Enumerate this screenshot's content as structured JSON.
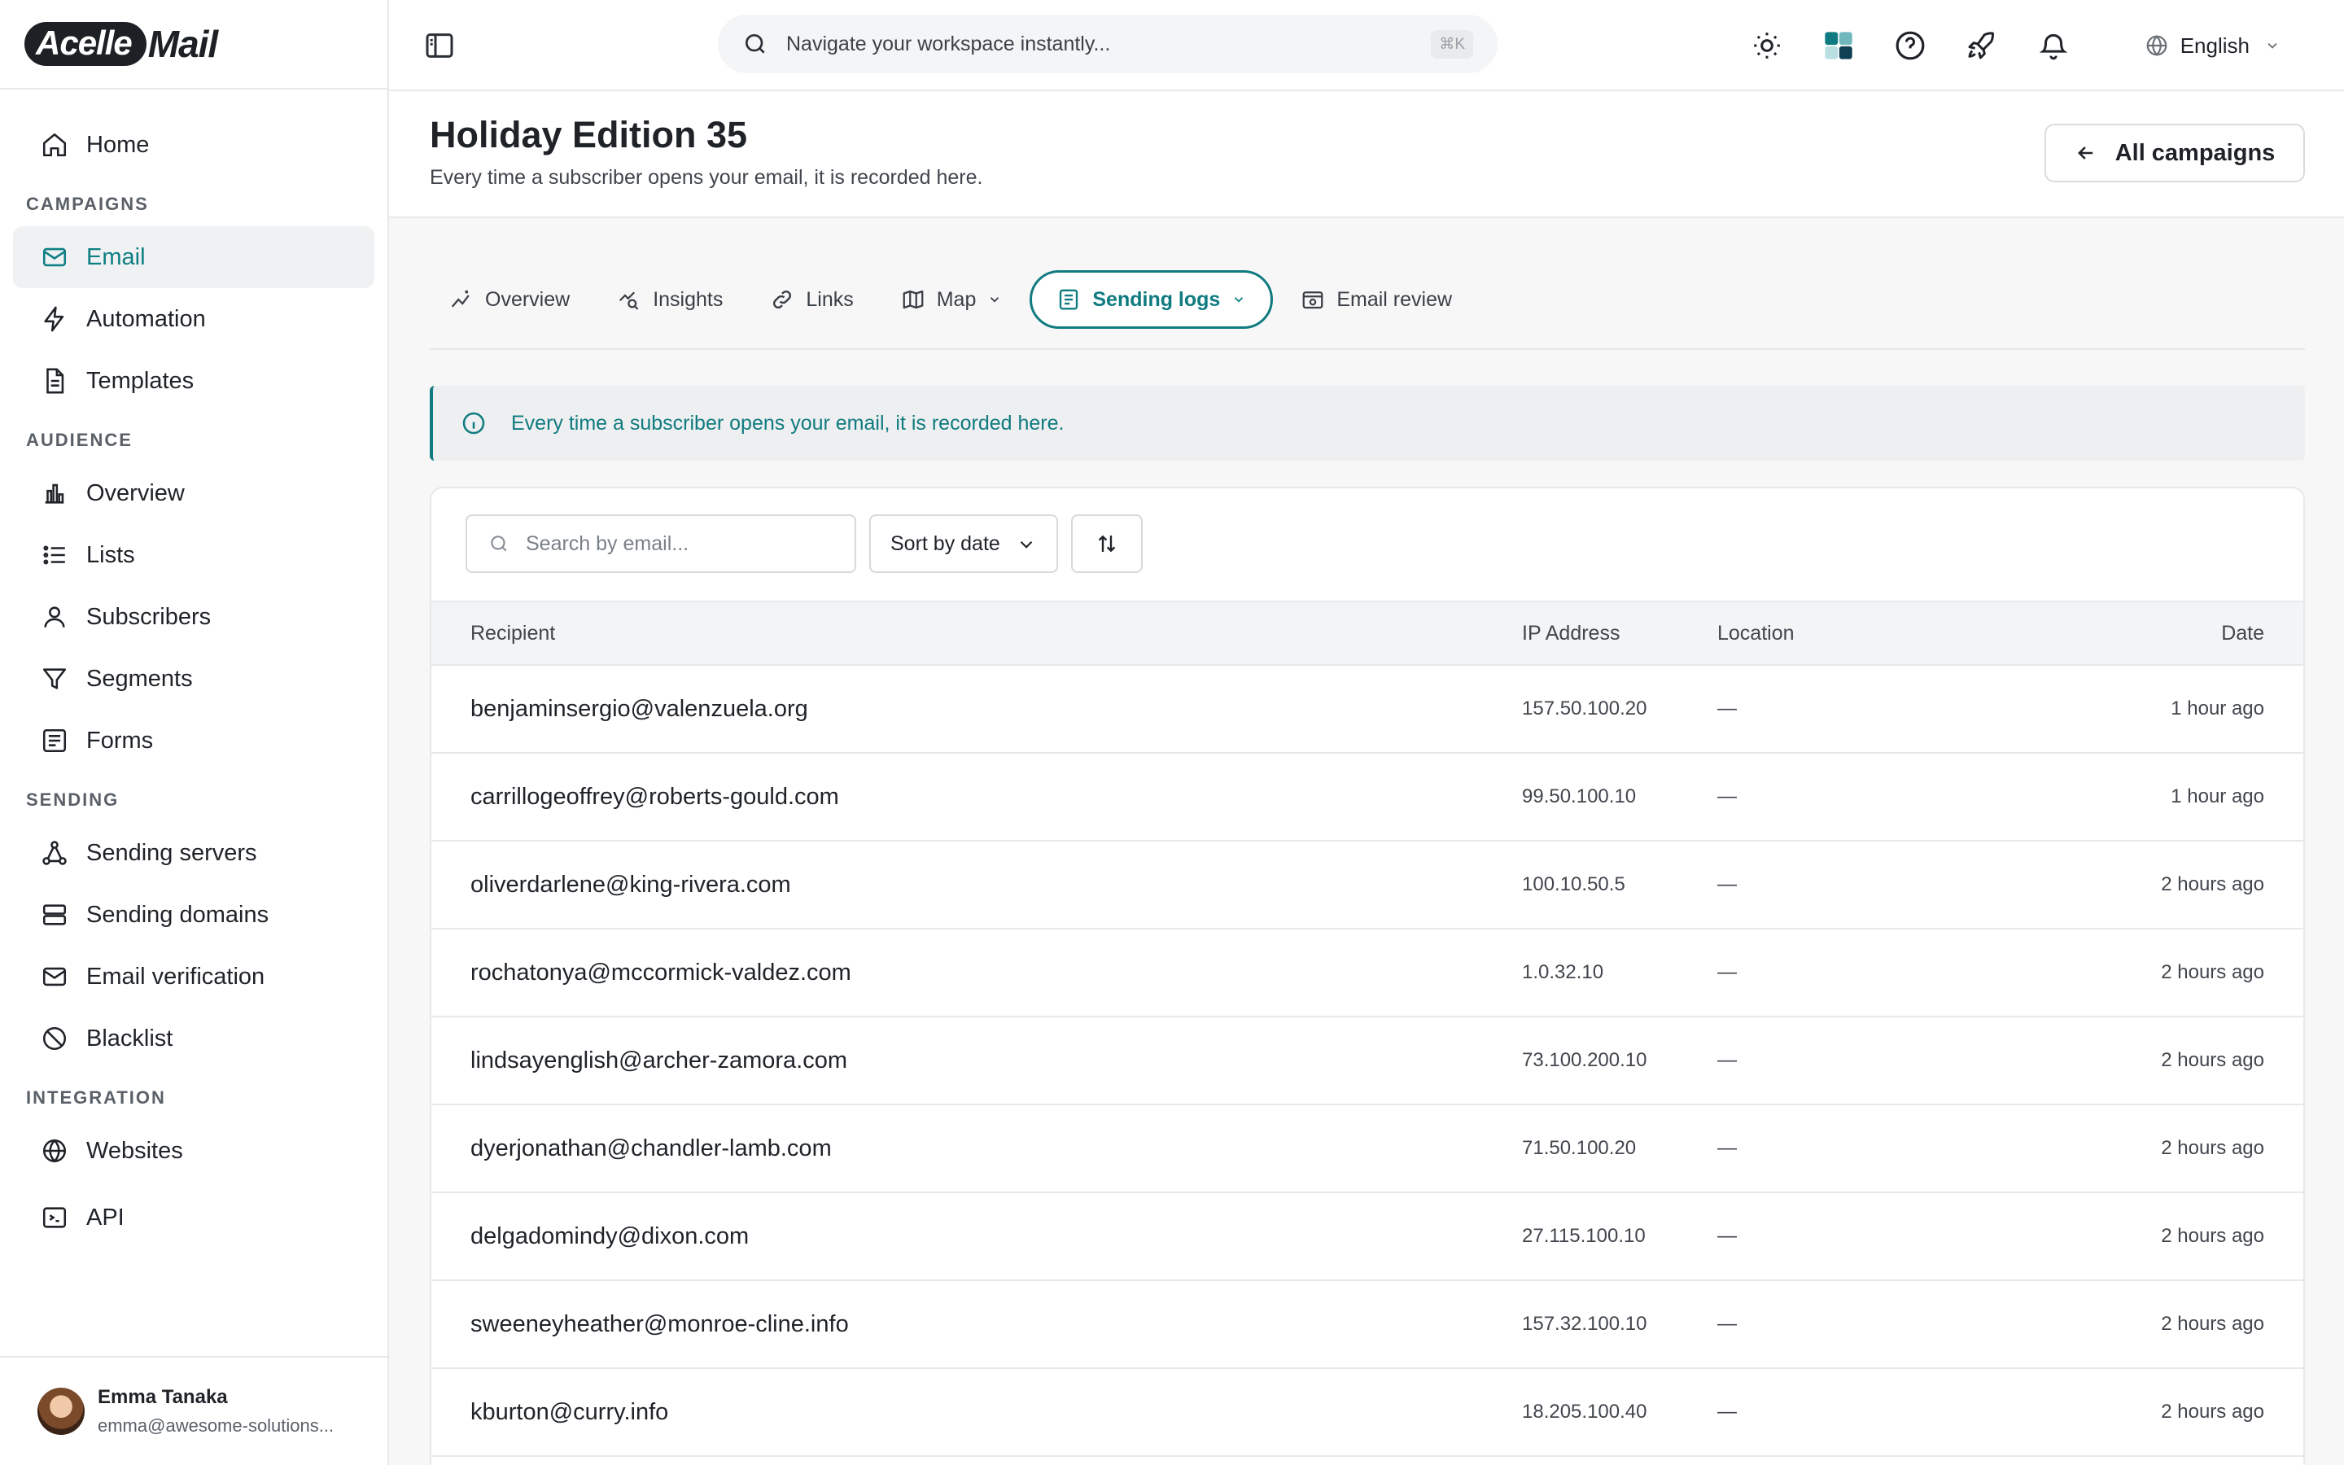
{
  "brand": {
    "logo_left": "Acelle",
    "logo_right": "Mail"
  },
  "sidebar": {
    "home": "Home",
    "sections": {
      "campaigns": "CAMPAIGNS",
      "audience": "AUDIENCE",
      "sending": "SENDING",
      "integration": "INTEGRATION"
    },
    "campaigns": [
      "Email",
      "Automation",
      "Templates"
    ],
    "audience": [
      "Overview",
      "Lists",
      "Subscribers",
      "Segments",
      "Forms"
    ],
    "sending": [
      "Sending servers",
      "Sending domains",
      "Email verification",
      "Blacklist"
    ],
    "integration": [
      "Websites",
      "API"
    ],
    "active_item": "Email"
  },
  "user": {
    "name": "Emma Tanaka",
    "email": "emma@awesome-solutions..."
  },
  "topbar": {
    "search_placeholder": "Navigate your workspace instantly...",
    "shortcut": "⌘K",
    "language": "English",
    "icons": [
      "theme-sun-icon",
      "app-grid-icon",
      "help-icon",
      "rocket-icon",
      "bell-icon"
    ]
  },
  "page": {
    "title": "Holiday Edition 35",
    "subtitle": "Every time a subscriber opens your email, it is recorded here.",
    "back_button": "All campaigns"
  },
  "tabs": [
    {
      "label": "Overview"
    },
    {
      "label": "Insights"
    },
    {
      "label": "Links"
    },
    {
      "label": "Map"
    },
    {
      "label": "Sending logs"
    },
    {
      "label": "Email review"
    }
  ],
  "active_tab": "Sending logs",
  "alert": {
    "text": "Every time a subscriber opens your email, it is recorded here."
  },
  "filters": {
    "search_placeholder": "Search by email...",
    "sort_label": "Sort by date"
  },
  "table": {
    "columns": [
      "Recipient",
      "IP Address",
      "Location",
      "Date"
    ],
    "rows": [
      {
        "recipient": "benjaminsergio@valenzuela.org",
        "ip": "157.50.100.20",
        "location": "—",
        "date": "1 hour ago"
      },
      {
        "recipient": "carrillogeoffrey@roberts-gould.com",
        "ip": "99.50.100.10",
        "location": "—",
        "date": "1 hour ago"
      },
      {
        "recipient": "oliverdarlene@king-rivera.com",
        "ip": "100.10.50.5",
        "location": "—",
        "date": "2 hours ago"
      },
      {
        "recipient": "rochatonya@mccormick-valdez.com",
        "ip": "1.0.32.10",
        "location": "—",
        "date": "2 hours ago"
      },
      {
        "recipient": "lindsayenglish@archer-zamora.com",
        "ip": "73.100.200.10",
        "location": "—",
        "date": "2 hours ago"
      },
      {
        "recipient": "dyerjonathan@chandler-lamb.com",
        "ip": "71.50.100.20",
        "location": "—",
        "date": "2 hours ago"
      },
      {
        "recipient": "delgadomindy@dixon.com",
        "ip": "27.115.100.10",
        "location": "—",
        "date": "2 hours ago"
      },
      {
        "recipient": "sweeneyheather@monroe-cline.info",
        "ip": "157.32.100.10",
        "location": "—",
        "date": "2 hours ago"
      },
      {
        "recipient": "kburton@curry.info",
        "ip": "18.205.100.40",
        "location": "—",
        "date": "2 hours ago"
      }
    ]
  },
  "colors": {
    "accent": "#0f7b80",
    "border": "#e6e8eb",
    "muted_bg": "#f7f7f8"
  }
}
